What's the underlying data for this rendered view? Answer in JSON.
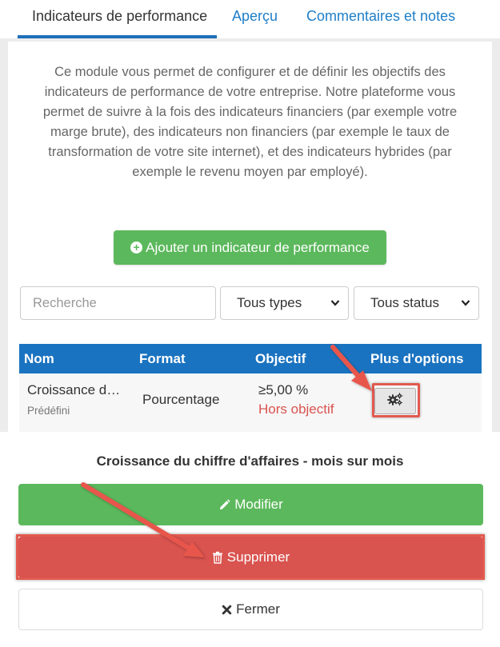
{
  "tabs": [
    {
      "label": "Indicateurs de performance",
      "active": true
    },
    {
      "label": "Aperçu",
      "active": false
    },
    {
      "label": "Commentaires et notes",
      "active": false
    }
  ],
  "description": "Ce module vous permet de configurer et de définir les objectifs des indicateurs de performance de votre entreprise. Notre plateforme vous permet de suivre à la fois des indicateurs financiers (par exemple votre marge brute), des indicateurs non financiers (par exemple le taux de transformation de votre site internet), et des indicateurs hybrides (par exemple le revenu moyen par employé).",
  "add_button": {
    "label": "Ajouter un indicateur de performance",
    "icon": "plus-circle-icon"
  },
  "filters": {
    "search_placeholder": "Recherche",
    "type_selected": "Tous types",
    "status_selected": "Tous status"
  },
  "table": {
    "headers": [
      "Nom",
      "Format",
      "Objectif",
      "Plus d'options"
    ],
    "rows": [
      {
        "name": "Croissance d…",
        "tag": "Prédéfini",
        "format": "Pourcentage",
        "objective": "≥5,00 %",
        "status": "Hors objectif",
        "options_icon": "gears-icon"
      }
    ]
  },
  "sheet": {
    "title": "Croissance du chiffre d'affaires - mois sur mois",
    "modify_label": "Modifier",
    "delete_label": "Supprimer",
    "close_label": "Fermer"
  },
  "colors": {
    "primary": "#1a73c0",
    "success": "#5cb85c",
    "danger": "#d9534f",
    "annotation": "#e25a4f"
  }
}
